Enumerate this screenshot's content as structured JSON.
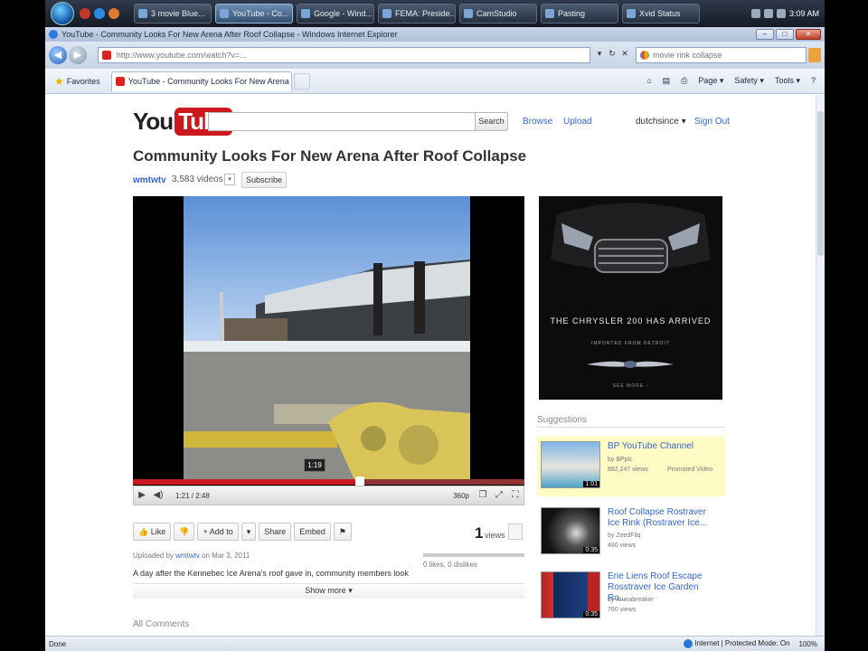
{
  "taskbar": {
    "tasks": [
      {
        "label": "3 movie Blue..."
      },
      {
        "label": "YouTube - Co..."
      },
      {
        "label": "Google - Wind..."
      },
      {
        "label": "FEMA: Preside..."
      },
      {
        "label": "CamStudio"
      },
      {
        "label": "Pasting"
      },
      {
        "label": "Xvid Status"
      }
    ],
    "clock": "3:09 AM"
  },
  "window": {
    "title": "YouTube - Community Looks For New Arena After Roof Collapse - Windows Internet Explorer",
    "address": "http://www.youtube.com/watch?v=...",
    "search_text": "movie rink collapse"
  },
  "favbar": {
    "favorites_label": "Favorites",
    "tab_label": "YouTube - Community Looks For New Arena Af...",
    "commands": [
      "Page ▾",
      "Safety ▾",
      "Tools ▾"
    ]
  },
  "youtube": {
    "logo_you": "You",
    "logo_tube": "Tube",
    "search_button": "Search",
    "browse": "Browse",
    "upload": "Upload",
    "username": "dutchsince ▾",
    "sign_out": "Sign Out"
  },
  "video": {
    "title": "Community Looks For New Arena After Roof Collapse",
    "channel": "wmtwtv",
    "video_count": "3,583 videos",
    "subscribe": "Subscribe",
    "tooltip_time": "1:19",
    "timecode": "1:21 / 2:48",
    "quality": "360p",
    "progress_played": 0.58
  },
  "actions": {
    "like": "Like",
    "add_to": "+ Add to",
    "share": "Share",
    "embed": "Embed",
    "views_num": "1",
    "views_lbl": "views",
    "uploaded_prefix": "Uploaded by",
    "uploader": "wmtwtv",
    "uploaded_date": "on Mar 3, 2011",
    "likes": "0 likes, 0 dislikes",
    "description": "A day after the Kennebec Ice Arena's roof gave in, community members look",
    "show_more": "Show more ▾",
    "all_comments": "All Comments"
  },
  "ad": {
    "headline": "THE CHRYSLER 200 HAS ARRIVED",
    "sub": "IMPORTED FROM DETROIT",
    "more": "SEE MORE ›"
  },
  "suggestions": {
    "title": "Suggestions",
    "items": [
      {
        "title": "BP YouTube Channel",
        "by": "by BPplc",
        "views": "882,247 views",
        "promo": "Promoted Video",
        "duration": "1:01"
      },
      {
        "title": "Roof Collapse Rostraver Ice Rink (Rostraver Ice...",
        "by": "by ZeedFilq",
        "views": "480 views",
        "duration": "0:35"
      },
      {
        "title": "Erie Liens Roof Escape Rosstraver Ice Garden Ro...",
        "by": "by rounabreaker",
        "views": "760 views",
        "duration": "0:35"
      }
    ]
  },
  "status": {
    "left": "Done",
    "zone": "Internet | Protected Mode: On",
    "zoom": "100%"
  }
}
